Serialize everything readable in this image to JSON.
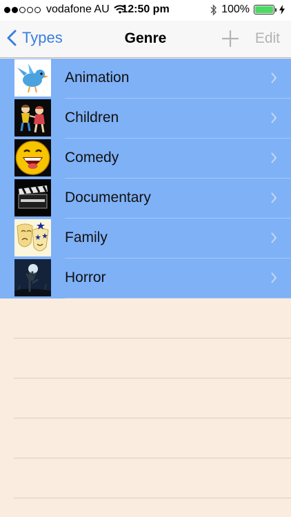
{
  "status": {
    "carrier": "vodafone AU",
    "time": "12:50 pm",
    "battery": "100%",
    "signal_bars": 2,
    "signal_total": 5
  },
  "nav": {
    "back_label": "Types",
    "title": "Genre",
    "edit_label": "Edit"
  },
  "colors": {
    "accent": "#3a7ee0",
    "row_bg": "#7fb1f7",
    "page_bg": "#faecdf",
    "battery": "#4cd964"
  },
  "genres": [
    {
      "label": "Animation",
      "icon": "blue-bird-icon"
    },
    {
      "label": "Children",
      "icon": "dancing-children-icon"
    },
    {
      "label": "Comedy",
      "icon": "laughing-face-icon"
    },
    {
      "label": "Documentary",
      "icon": "clapperboard-icon"
    },
    {
      "label": "Family",
      "icon": "theater-masks-icon"
    },
    {
      "label": "Horror",
      "icon": "zombie-hand-icon"
    }
  ]
}
